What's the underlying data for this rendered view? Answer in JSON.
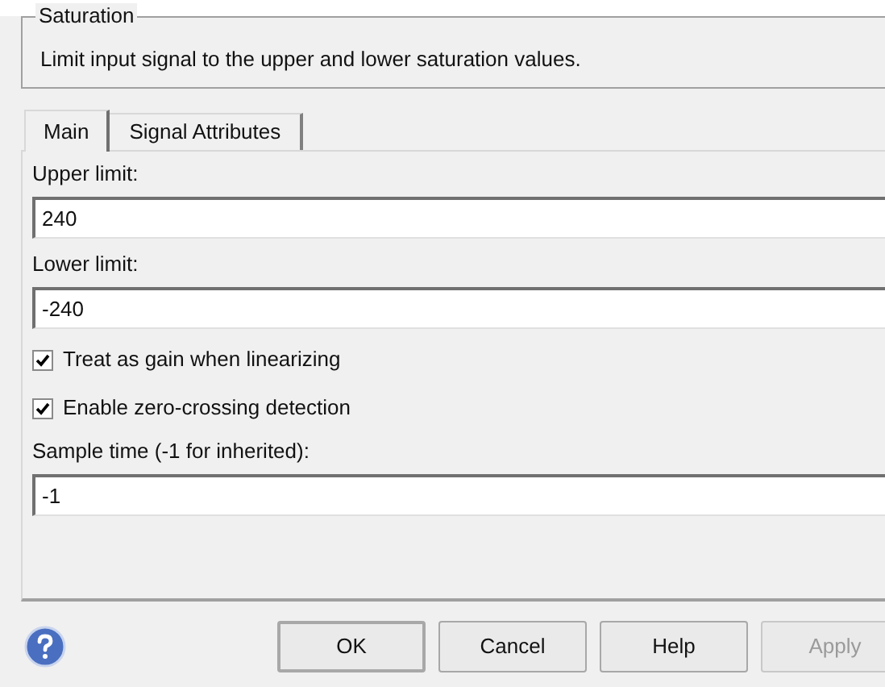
{
  "group": {
    "title": "Saturation",
    "description": "Limit input signal to the upper and lower saturation values."
  },
  "tabs": [
    {
      "label": "Main",
      "selected": true
    },
    {
      "label": "Signal Attributes",
      "selected": false
    }
  ],
  "params": [
    {
      "kind": "field",
      "label": "Upper limit:",
      "value": "240"
    },
    {
      "kind": "field",
      "label": "Lower limit:",
      "value": "-240"
    },
    {
      "kind": "checkbox",
      "label": "Treat as gain when linearizing",
      "checked": true
    },
    {
      "kind": "checkbox",
      "label": "Enable zero-crossing detection",
      "checked": true
    },
    {
      "kind": "field",
      "label": "Sample time (-1 for inherited):",
      "value": "-1"
    }
  ],
  "buttons": [
    {
      "label": "OK",
      "disabled": false,
      "default": true
    },
    {
      "label": "Cancel",
      "disabled": false,
      "default": false
    },
    {
      "label": "Help",
      "disabled": false,
      "default": false
    },
    {
      "label": "Apply",
      "disabled": true,
      "default": false
    }
  ]
}
